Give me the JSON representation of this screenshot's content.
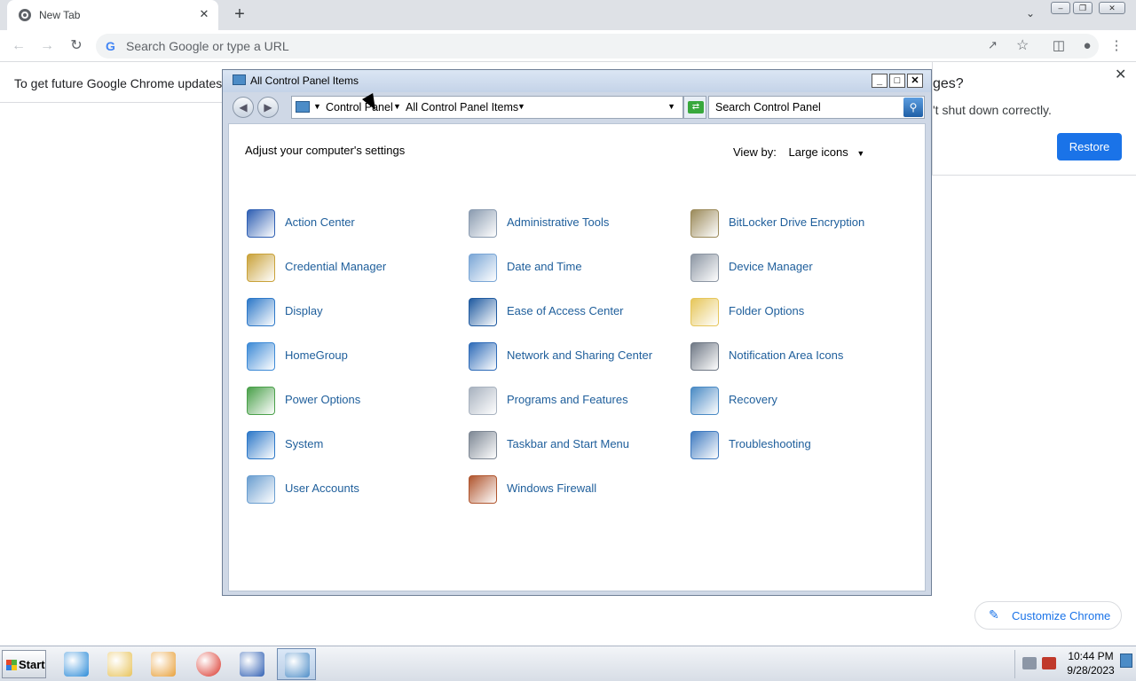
{
  "chrome": {
    "tab_title": "New Tab",
    "tab_close": "✕",
    "new_tab": "+",
    "omnibox_placeholder": "Search Google or type a URL",
    "infobar_text": "To get future Google Chrome updates, yo",
    "restore": {
      "question_fragment": "ges?",
      "message_fragment": "'t shut down correctly.",
      "button": "Restore"
    },
    "customize_label": "Customize Chrome"
  },
  "control_panel": {
    "window_title": "All Control Panel Items",
    "breadcrumb": [
      "Control Panel",
      "All Control Panel Items"
    ],
    "search_placeholder": "Search Control Panel",
    "heading": "Adjust your computer's settings",
    "view_by_label": "View by:",
    "view_by_value": "Large icons",
    "items": [
      {
        "label": "Action Center",
        "icon": "action-center-icon",
        "color": "#2f5fb3"
      },
      {
        "label": "Administrative Tools",
        "icon": "administrative-tools-icon",
        "color": "#8a9bb0"
      },
      {
        "label": "BitLocker Drive Encryption",
        "icon": "bitlocker-icon",
        "color": "#9b8a5a"
      },
      {
        "label": "Credential Manager",
        "icon": "credential-manager-icon",
        "color": "#c9a23a"
      },
      {
        "label": "Date and Time",
        "icon": "date-time-icon",
        "color": "#7aa6d6"
      },
      {
        "label": "Device Manager",
        "icon": "device-manager-icon",
        "color": "#8c96a3"
      },
      {
        "label": "Display",
        "icon": "display-icon",
        "color": "#2d78c8"
      },
      {
        "label": "Ease of Access Center",
        "icon": "ease-of-access-icon",
        "color": "#1f5aa0"
      },
      {
        "label": "Folder Options",
        "icon": "folder-options-icon",
        "color": "#e6c65a"
      },
      {
        "label": "HomeGroup",
        "icon": "homegroup-icon",
        "color": "#3d8ad6"
      },
      {
        "label": "Network and Sharing Center",
        "icon": "network-sharing-icon",
        "color": "#2e6bb8"
      },
      {
        "label": "Notification Area Icons",
        "icon": "notification-area-icon",
        "color": "#6f7885"
      },
      {
        "label": "Power Options",
        "icon": "power-options-icon",
        "color": "#4aa04a"
      },
      {
        "label": "Programs and Features",
        "icon": "programs-features-icon",
        "color": "#a8b2bf"
      },
      {
        "label": "Recovery",
        "icon": "recovery-icon",
        "color": "#4a8ac4"
      },
      {
        "label": "System",
        "icon": "system-icon",
        "color": "#2d78c8"
      },
      {
        "label": "Taskbar and Start Menu",
        "icon": "taskbar-start-menu-icon",
        "color": "#7d8794"
      },
      {
        "label": "Troubleshooting",
        "icon": "troubleshooting-icon",
        "color": "#3f7ac0"
      },
      {
        "label": "User Accounts",
        "icon": "user-accounts-icon",
        "color": "#6a9ed0"
      },
      {
        "label": "Windows Firewall",
        "icon": "windows-firewall-icon",
        "color": "#b0552e"
      }
    ]
  },
  "taskbar": {
    "start_label": "Start",
    "apps": [
      {
        "name": "internet-explorer-icon",
        "color": "#2a8ad8"
      },
      {
        "name": "explorer-icon",
        "color": "#e8c35a"
      },
      {
        "name": "media-player-icon",
        "color": "#e8a03a"
      },
      {
        "name": "chrome-icon",
        "color": "#d93025"
      },
      {
        "name": "action-center-flag-icon",
        "color": "#2f5fb3"
      },
      {
        "name": "control-panel-icon",
        "color": "#4c8cc7"
      }
    ],
    "time": "10:44 PM",
    "date": "9/28/2023"
  }
}
